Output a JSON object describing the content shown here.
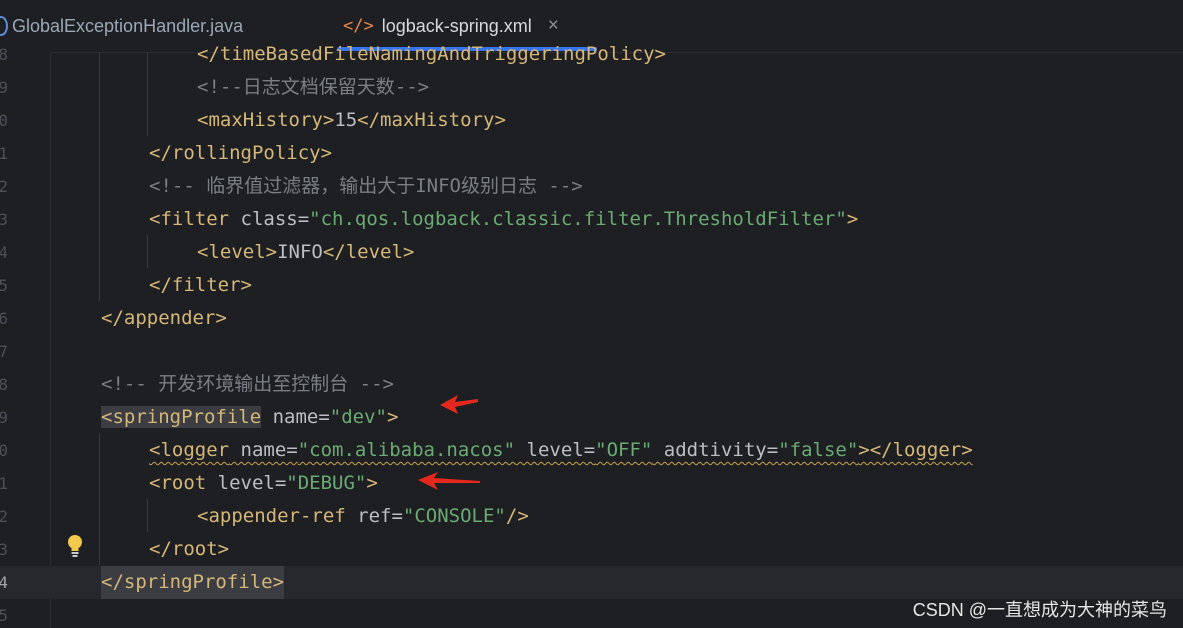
{
  "tabs": [
    {
      "label": "GlobalExceptionHandler.java",
      "icon": "java-class-icon",
      "active": false
    },
    {
      "label": "logback-spring.xml",
      "icon": "xml-file-icon",
      "active": true
    }
  ],
  "tab_close_glyph": "×",
  "xml_icon_glyph": "</>",
  "editor": {
    "line_numbers": [
      "8",
      "9",
      "0",
      "1",
      "2",
      "3",
      "4",
      "5",
      "6",
      "7",
      "8",
      "9",
      "0",
      "1",
      "2",
      "3",
      "4",
      "5"
    ],
    "current_line_number": "4",
    "lines": {
      "l1": "</timeBasedFileNamingAndTriggeringPolicy>",
      "l2": "<!--日志文档保留天数-->",
      "l3": {
        "open": "<maxHistory>",
        "text": "15",
        "close": "</maxHistory>"
      },
      "l4": "</rollingPolicy>",
      "l5": "<!-- 临界值过滤器，输出大于INFO级别日志 -->",
      "l6": {
        "open": "<filter",
        "attr": " class=",
        "value": "\"ch.qos.logback.classic.filter.ThresholdFilter\"",
        "close": ">"
      },
      "l7": {
        "open": "<level>",
        "text": "INFO",
        "close": "</level>"
      },
      "l8": "</filter>",
      "l9": "</appender>",
      "l11": "<!-- 开发环境输出至控制台 -->",
      "l12": {
        "open": "<springProfile",
        "attr": " name=",
        "value": "\"dev\"",
        "close": ">"
      },
      "l13": {
        "open": "<logger",
        "a1": " name=",
        "v1": "\"com.alibaba.nacos\"",
        "a2": " level=",
        "v2": "\"OFF\"",
        "a3": " addtivity=",
        "v3": "\"false\"",
        "close": "></logger>"
      },
      "l14": {
        "open": "<root",
        "attr": " level=",
        "value": "\"DEBUG\"",
        "close": ">"
      },
      "l15": {
        "open": "<appender-ref",
        "attr": " ref=",
        "value": "\"CONSOLE\"",
        "close": "/>"
      },
      "l16": "</root>",
      "l17": "</springProfile>"
    }
  },
  "colors": {
    "background": "#1e1f22",
    "tag": "#d5b778",
    "string": "#6aab73",
    "comment": "#7a7e85",
    "text": "#bcbec4",
    "tab_accent": "#3574f0",
    "arrow": "#e5281e"
  },
  "annotations": [
    "red-arrow",
    "red-arrow"
  ],
  "intention_icon": "lightbulb-icon",
  "watermark": "CSDN @一直想成为大神的菜鸟"
}
